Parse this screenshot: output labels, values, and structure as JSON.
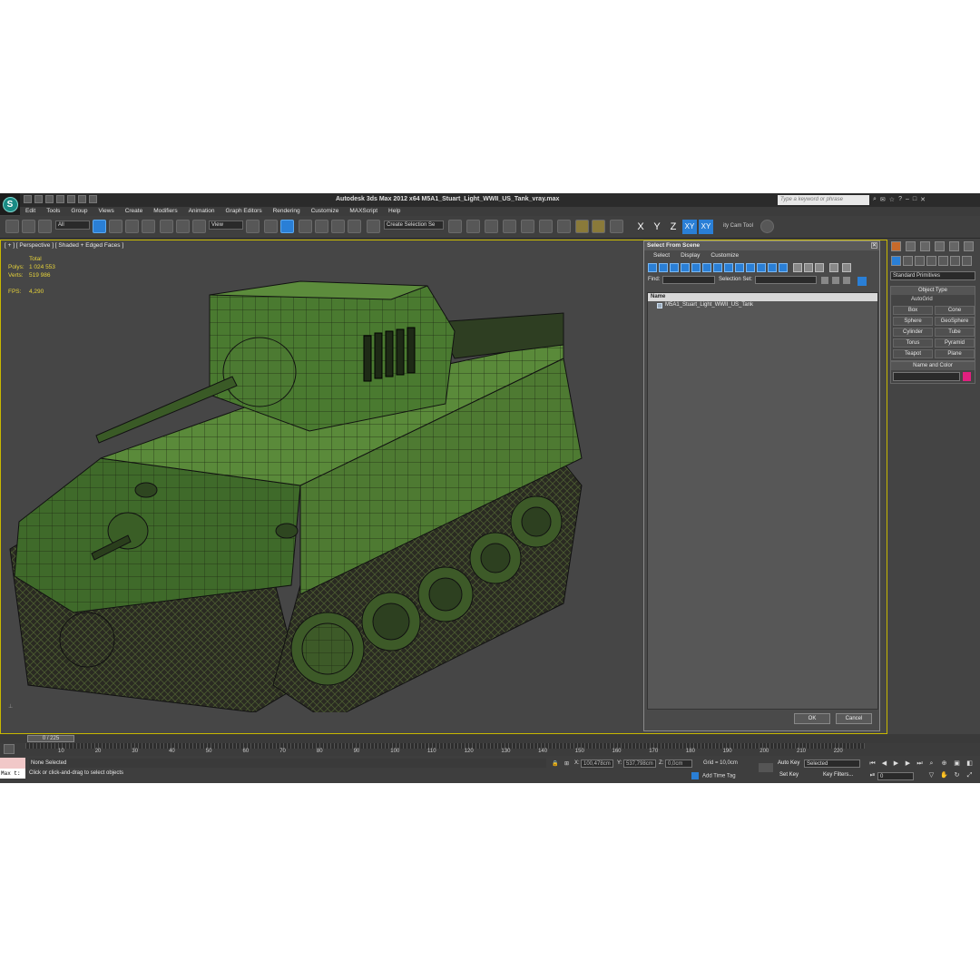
{
  "app": {
    "title": "Autodesk 3ds Max  2012 x64     M5A1_Stuart_Light_WWII_US_Tank_vray.max",
    "search_placeholder": "Type a keyword or phrase",
    "logo": "3ds-max-logo"
  },
  "menu": [
    "Edit",
    "Tools",
    "Group",
    "Views",
    "Create",
    "Modifiers",
    "Animation",
    "Graph Editors",
    "Rendering",
    "Customize",
    "MAXScript",
    "Help"
  ],
  "toolbar": {
    "filter_value": "All",
    "refcoord_value": "View",
    "selection_set_value": "Create Selection Se",
    "axes": [
      "X",
      "Y",
      "Z",
      "XY",
      "XY"
    ],
    "extra_label": "ity Cam Tool"
  },
  "viewport": {
    "label": "[ + ] [ Perspective ] [ Shaded + Edged Faces ]",
    "stats_total": "Total",
    "polys_label": "Polys:",
    "polys_value": "1 024 553",
    "verts_label": "Verts:",
    "verts_value": "519 986",
    "fps_label": "FPS:",
    "fps_value": "4,290"
  },
  "dialog": {
    "title": "Select From Scene",
    "menu": [
      "Select",
      "Display",
      "Customize"
    ],
    "find_label": "Find:",
    "selection_set_label": "Selection Set:",
    "column_name": "Name",
    "items": [
      "M5A1_Stuart_Light_WWII_US_Tank"
    ],
    "ok_label": "OK",
    "cancel_label": "Cancel"
  },
  "command_panel": {
    "category": "Standard Primitives",
    "object_type_title": "Object Type",
    "autogrid_label": "AutoGrid",
    "primitives": [
      "Box",
      "Cone",
      "Sphere",
      "GeoSphere",
      "Cylinder",
      "Tube",
      "Torus",
      "Pyramid",
      "Teapot",
      "Plane"
    ],
    "name_color_title": "Name and Color",
    "color": "#e0207f"
  },
  "timeline": {
    "frame_indicator": "0 / 225",
    "ticks": [
      "10",
      "20",
      "30",
      "40",
      "50",
      "60",
      "70",
      "80",
      "90",
      "100",
      "110",
      "120",
      "130",
      "140",
      "150",
      "160",
      "170",
      "180",
      "190",
      "200",
      "210",
      "220"
    ]
  },
  "status": {
    "maxscript_label": "Max t:",
    "selection_text": "None Selected",
    "prompt_text": "Click or click-and-drag to select objects",
    "x_label": "X:",
    "x_value": "100,478cm",
    "y_label": "Y:",
    "y_value": "537,798cm",
    "z_label": "Z:",
    "z_value": "0,0cm",
    "grid_text": "Grid = 10,0cm",
    "add_time_tag": "Add Time Tag",
    "auto_key": "Auto Key",
    "set_key": "Set Key",
    "selected_value": "Selected",
    "key_filters": "Key Filters...",
    "current_frame": "0"
  }
}
